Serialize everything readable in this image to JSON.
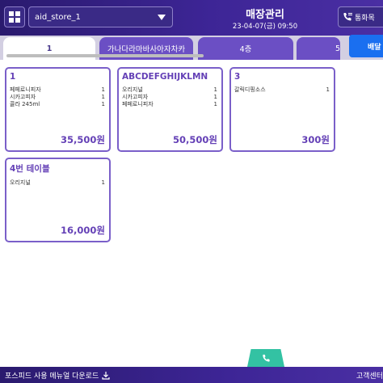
{
  "header": {
    "menu_icon": "grid-icon",
    "store_name": "aid_store_1",
    "title": "매장관리",
    "datetime": "23-04-07(금) 09:50",
    "call_button": "통화목"
  },
  "tabs": [
    {
      "label": "1",
      "active": true
    },
    {
      "label": "가나다라마바사아자차카",
      "active": false
    },
    {
      "label": "4층",
      "active": false
    },
    {
      "label": "5",
      "active": false
    }
  ],
  "delivery_button": "배달",
  "tables": [
    {
      "name": "1",
      "items": [
        {
          "menu": "페페로니피자",
          "qty": "1"
        },
        {
          "menu": "시카고피자",
          "qty": "1"
        },
        {
          "menu": "콜라 245ml",
          "qty": "1"
        }
      ],
      "total": "35,500원"
    },
    {
      "name": "ABCDEFGHIJKLMN",
      "items": [
        {
          "menu": "오리지널",
          "qty": "1"
        },
        {
          "menu": "시카고피자",
          "qty": "1"
        },
        {
          "menu": "페페로니피자",
          "qty": "1"
        }
      ],
      "total": "50,500원"
    },
    {
      "name": "3",
      "items": [
        {
          "menu": "갈릭디핑소스",
          "qty": "1"
        }
      ],
      "total": "300원"
    },
    {
      "name": "4번 테이블",
      "items": [
        {
          "menu": "오리지널",
          "qty": "1"
        }
      ],
      "total": "16,000원"
    }
  ],
  "footer": {
    "manual_label": "포스피드 사용 메뉴얼 다운로드",
    "support_label": "고객센터"
  },
  "colors": {
    "header_bg": "#3d2596",
    "accent": "#6440b6",
    "delivery": "#1a6ff0",
    "phone_tab": "#33c2a3"
  }
}
